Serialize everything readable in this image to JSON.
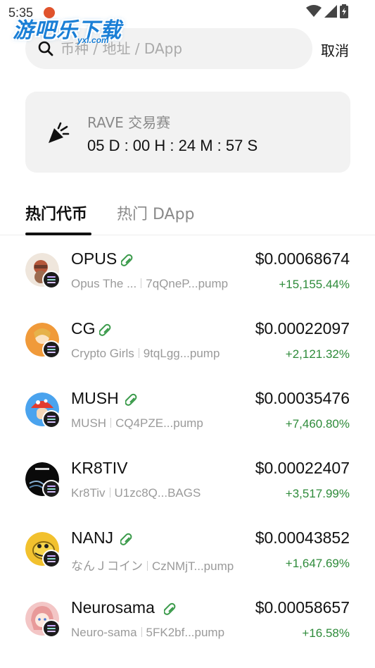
{
  "status_bar": {
    "time": "5:35"
  },
  "watermark": {
    "text": "游吧乐下载",
    "sub": "yxl.com"
  },
  "search": {
    "placeholder": "币种 / 地址 / DApp",
    "value": "",
    "cancel_label": "取消"
  },
  "event": {
    "title": "RAVE 交易赛",
    "countdown": "05 D : 00 H : 24 M : 57 S",
    "icon": "party-popper-icon"
  },
  "tabs": [
    {
      "label": "热门代币",
      "active": true
    },
    {
      "label": "热门 DApp",
      "active": false
    }
  ],
  "colors": {
    "positive": "#2e8b3a",
    "card_bg": "#f2f2f2",
    "pill_green": "#3a9a4a"
  },
  "tokens": [
    {
      "symbol": "OPUS",
      "name": "Opus The ...",
      "address": "7qQneP...pump",
      "price": "$0.00068674",
      "change": "+15,155.44%",
      "has_pill": true,
      "avatar_color": "#e9d6c2"
    },
    {
      "symbol": "CG",
      "name": "Crypto Girls",
      "address": "9tqLgg...pump",
      "price": "$0.00022097",
      "change": "+2,121.32%",
      "has_pill": true,
      "avatar_color": "#f09a3a"
    },
    {
      "symbol": "MUSH",
      "name": "MUSH",
      "address": "CQ4PZE...pump",
      "price": "$0.00035476",
      "change": "+7,460.80%",
      "has_pill": true,
      "avatar_color": "#3a8fe0"
    },
    {
      "symbol": "KR8TIV",
      "name": "Kr8Tiv",
      "address": "U1zc8Q...BAGS",
      "price": "$0.00022407",
      "change": "+3,517.99%",
      "has_pill": false,
      "avatar_color": "#0a0a0a"
    },
    {
      "symbol": "NANJ",
      "name": "なんＪコイン",
      "address": "CzNMjT...pump",
      "price": "$0.00043852",
      "change": "+1,647.69%",
      "has_pill": true,
      "avatar_color": "#f2c12e"
    },
    {
      "symbol": "Neurosama",
      "name": "Neuro-sama",
      "address": "5FK2bf...pump",
      "price": "$0.00058657",
      "change": "+16.58%",
      "has_pill": true,
      "avatar_color": "#f3b8b8"
    }
  ]
}
